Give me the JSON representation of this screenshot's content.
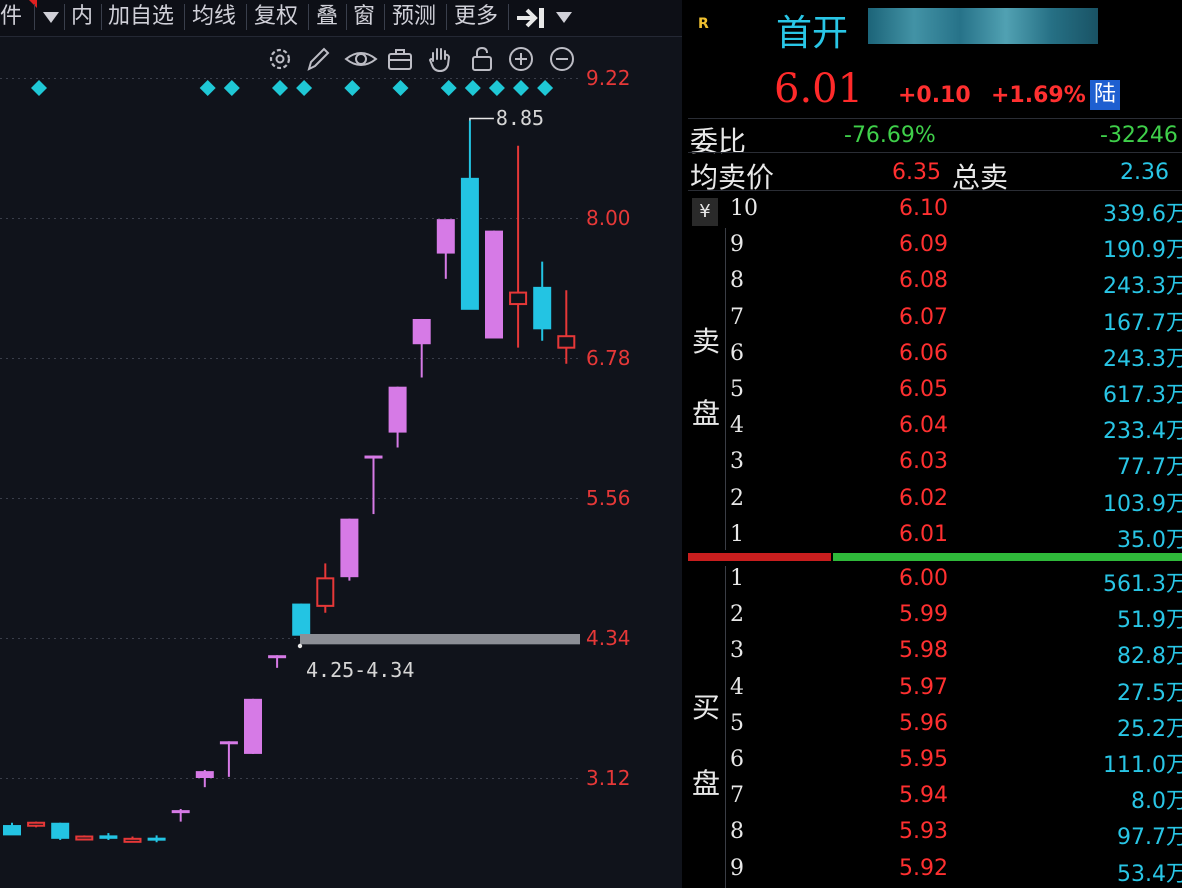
{
  "toolbar": {
    "items": [
      "件",
      "内",
      "加自选",
      "均线",
      "复权",
      "叠",
      "窗",
      "预测",
      "更多"
    ],
    "expand_icon": "arrow-to-right-icon",
    "dropdown_icon": "dropdown-triangle-icon"
  },
  "icon_row": [
    "settings-icon",
    "pen-icon",
    "eye-icon",
    "toolbox-icon",
    "hand-icon",
    "lock-icon",
    "zoom-in-icon",
    "zoom-out-icon"
  ],
  "colors": {
    "rise": "#e63838",
    "fall": "#23c4e3",
    "rise_limit": "#d67ae6",
    "signal": "#1fc8d6",
    "background": "#10131b"
  },
  "chart_data": {
    "type": "candlestick",
    "y_axis_labels": [
      "9.22",
      "8.00",
      "6.78",
      "5.56",
      "4.34",
      "3.12"
    ],
    "ylim": [
      2.75,
      9.55
    ],
    "high_annotation": "8.85",
    "gap_annotation": "4.25-4.34",
    "gap_range": [
      4.25,
      4.34
    ],
    "candles": [
      {
        "o": 2.71,
        "h": 2.73,
        "l": 2.63,
        "c": 2.62,
        "kind": "fall"
      },
      {
        "o": 2.73,
        "h": 2.74,
        "l": 2.69,
        "c": 2.72,
        "kind": "rise"
      },
      {
        "o": 2.73,
        "h": 2.73,
        "l": 2.58,
        "c": 2.59,
        "kind": "fall"
      },
      {
        "o": 2.61,
        "h": 2.62,
        "l": 2.58,
        "c": 2.6,
        "kind": "rise"
      },
      {
        "o": 2.62,
        "h": 2.64,
        "l": 2.58,
        "c": 2.59,
        "kind": "fall"
      },
      {
        "o": 2.59,
        "h": 2.61,
        "l": 2.56,
        "c": 2.59,
        "kind": "rise"
      },
      {
        "o": 2.6,
        "h": 2.62,
        "l": 2.56,
        "c": 2.58,
        "kind": "fall"
      },
      {
        "o": 2.84,
        "h": 2.85,
        "l": 2.74,
        "c": 2.84,
        "kind": "limit"
      },
      {
        "o": 3.18,
        "h": 3.19,
        "l": 3.04,
        "c": 3.12,
        "kind": "limit"
      },
      {
        "o": 3.42,
        "h": 3.44,
        "l": 3.13,
        "c": 3.44,
        "kind": "limit"
      },
      {
        "o": 3.33,
        "h": 3.81,
        "l": 3.33,
        "c": 3.81,
        "kind": "limit"
      },
      {
        "o": 4.17,
        "h": 4.19,
        "l": 4.08,
        "c": 4.19,
        "kind": "limit"
      },
      {
        "o": 4.36,
        "h": 4.64,
        "l": 4.34,
        "c": 4.64,
        "kind": "fall"
      },
      {
        "o": 4.62,
        "h": 4.99,
        "l": 4.56,
        "c": 4.86,
        "kind": "rise"
      },
      {
        "o": 4.87,
        "h": 5.38,
        "l": 4.84,
        "c": 5.38,
        "kind": "limit"
      },
      {
        "o": 5.91,
        "h": 5.93,
        "l": 5.42,
        "c": 5.93,
        "kind": "limit"
      },
      {
        "o": 6.13,
        "h": 6.53,
        "l": 6.0,
        "c": 6.53,
        "kind": "limit"
      },
      {
        "o": 6.9,
        "h": 7.12,
        "l": 6.61,
        "c": 7.12,
        "kind": "limit"
      },
      {
        "o": 7.69,
        "h": 7.87,
        "l": 7.47,
        "c": 7.99,
        "kind": "limit"
      },
      {
        "o": 8.35,
        "h": 8.85,
        "l": 7.65,
        "c": 7.2,
        "kind": "fall"
      },
      {
        "o": 7.89,
        "h": 7.89,
        "l": 6.97,
        "c": 6.95,
        "kind": "limit"
      },
      {
        "o": 7.35,
        "h": 8.63,
        "l": 6.87,
        "c": 7.25,
        "kind": "rise"
      },
      {
        "o": 7.03,
        "h": 7.62,
        "l": 6.93,
        "c": 7.4,
        "kind": "fall"
      },
      {
        "o": 6.97,
        "h": 7.37,
        "l": 6.73,
        "c": 6.87,
        "kind": "rise"
      }
    ],
    "signal_markers": [
      0,
      7,
      8,
      10,
      11,
      13,
      15,
      17,
      18,
      19,
      20,
      21
    ]
  },
  "quote": {
    "market_badge": "R",
    "name": "首开",
    "price": "6.01",
    "change": "+0.10",
    "change_pct": "+1.69%",
    "exchange_badge": "陆",
    "weibi_label": "委比",
    "weibi_pct": "-76.69%",
    "weibi_diff": "-32246",
    "avg_sell_label": "均卖价",
    "avg_sell_price": "6.35",
    "total_sell_label": "总卖",
    "total_sell_value": "2.36",
    "currency_badge": "¥",
    "sell_label_1": "卖",
    "sell_label_2": "盘",
    "buy_label_1": "买",
    "buy_label_2": "盘",
    "sell_rows": [
      {
        "idx": "10",
        "price": "6.10",
        "vol": "339.6万"
      },
      {
        "idx": "9",
        "price": "6.09",
        "vol": "190.9万"
      },
      {
        "idx": "8",
        "price": "6.08",
        "vol": "243.3万"
      },
      {
        "idx": "7",
        "price": "6.07",
        "vol": "167.7万"
      },
      {
        "idx": "6",
        "price": "6.06",
        "vol": "243.3万"
      },
      {
        "idx": "5",
        "price": "6.05",
        "vol": "617.3万"
      },
      {
        "idx": "4",
        "price": "6.04",
        "vol": "233.4万"
      },
      {
        "idx": "3",
        "price": "6.03",
        "vol": "77.7万"
      },
      {
        "idx": "2",
        "price": "6.02",
        "vol": "103.9万"
      },
      {
        "idx": "1",
        "price": "6.01",
        "vol": "35.0万"
      }
    ],
    "buy_rows": [
      {
        "idx": "1",
        "price": "6.00",
        "vol": "561.3万"
      },
      {
        "idx": "2",
        "price": "5.99",
        "vol": "51.9万"
      },
      {
        "idx": "3",
        "price": "5.98",
        "vol": "82.8万"
      },
      {
        "idx": "4",
        "price": "5.97",
        "vol": "27.5万"
      },
      {
        "idx": "5",
        "price": "5.96",
        "vol": "25.2万"
      },
      {
        "idx": "6",
        "price": "5.95",
        "vol": "111.0万"
      },
      {
        "idx": "7",
        "price": "5.94",
        "vol": "8.0万"
      },
      {
        "idx": "8",
        "price": "5.93",
        "vol": "97.7万"
      },
      {
        "idx": "9",
        "price": "5.92",
        "vol": "53.4万"
      }
    ],
    "weibi_split": 0.29
  }
}
